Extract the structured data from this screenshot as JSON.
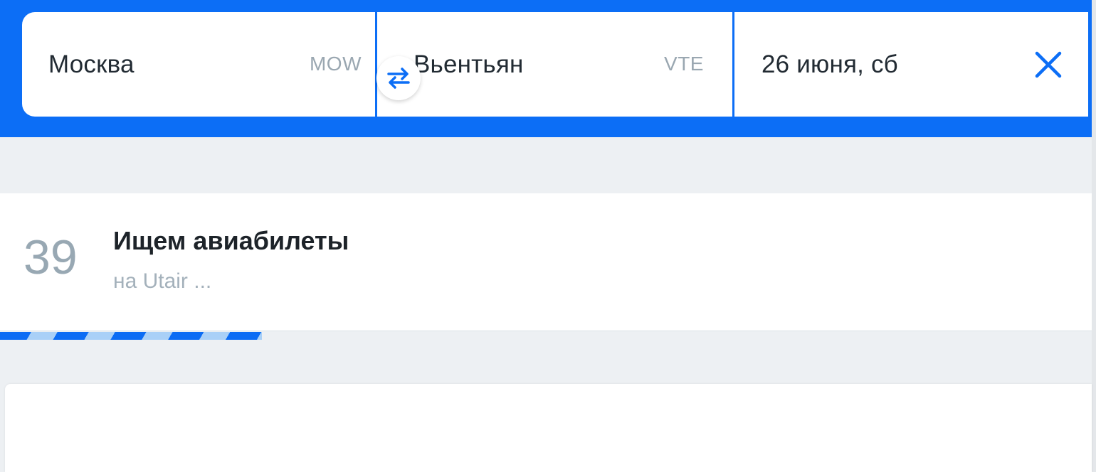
{
  "search": {
    "origin": {
      "city": "Москва",
      "code": "MOW"
    },
    "destination": {
      "city": "Вьентьян",
      "code": "VTE"
    },
    "date": "26 июня, сб",
    "swap_icon": "swap-arrows-icon",
    "clear_icon": "close-icon"
  },
  "status": {
    "counter": "39",
    "title": "Ищем авиабилеты",
    "subtitle": "на Utair ..."
  },
  "progress": {
    "fraction": 0.24
  },
  "colors": {
    "brand": "#0c6ef6",
    "background": "#edf0f3",
    "progress_light": "#a9d0f7"
  }
}
